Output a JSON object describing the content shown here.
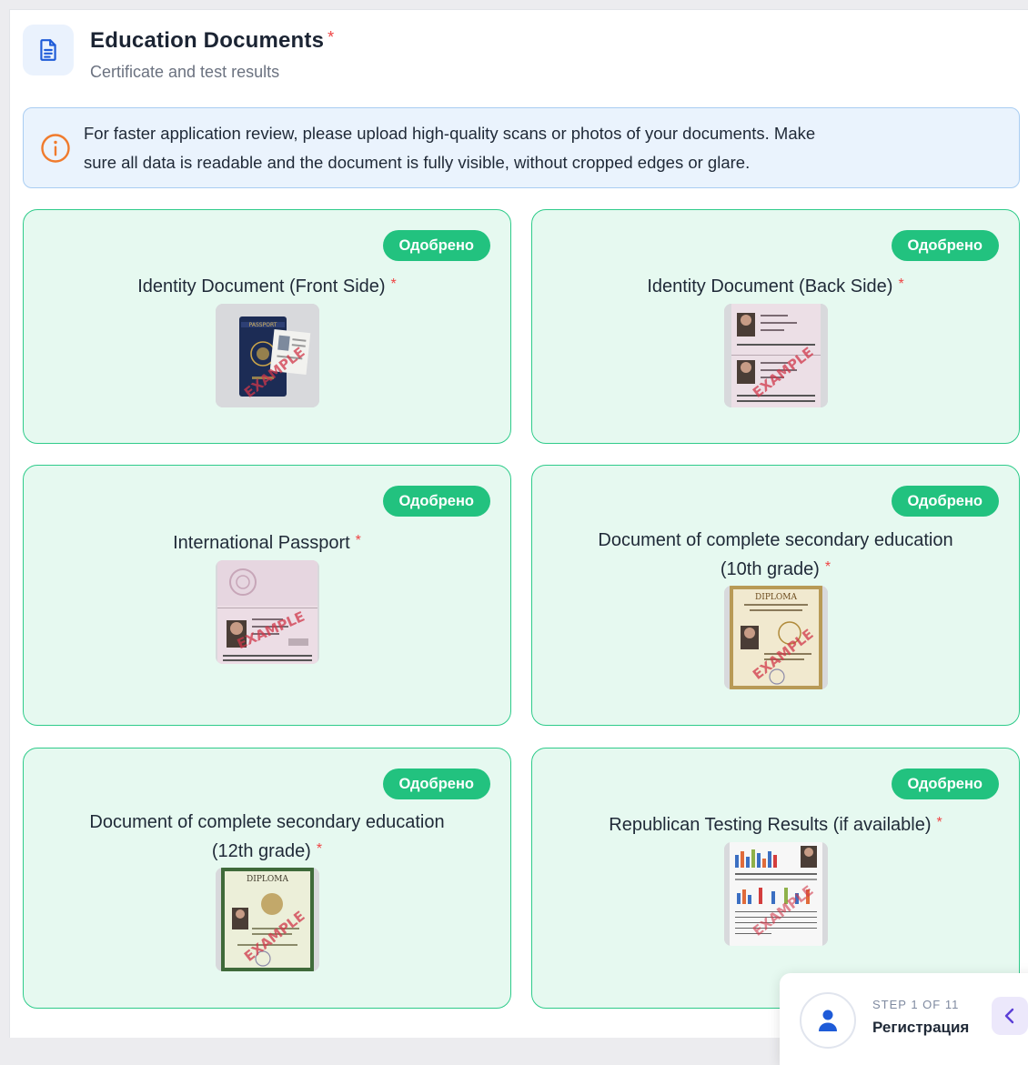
{
  "header": {
    "icon": "document-icon",
    "title": "Education Documents",
    "required_mark": "*",
    "subtitle": "Certificate and test results"
  },
  "notice": {
    "icon": "info-icon",
    "line1": "For faster application review, please upload high-quality scans or photos of your documents. Make",
    "line2": "sure all data is readable and the document is fully visible, without cropped edges or glare."
  },
  "cards": [
    {
      "status": "Одобрено",
      "title_line1": "Identity Document (Front Side)",
      "title_line2": "",
      "required_mark": "*",
      "thumb_icon": "passport-cover-example-image",
      "watermark": "EXAMPLE"
    },
    {
      "status": "Одобрено",
      "title_line1": "Identity Document (Back Side)",
      "title_line2": "",
      "required_mark": "*",
      "thumb_icon": "passport-pages-example-image",
      "watermark": "EXAMPLE"
    },
    {
      "status": "Одобрено",
      "title_line1": "International Passport",
      "title_line2": "",
      "required_mark": "*",
      "thumb_icon": "international-passport-example-image",
      "watermark": "EXAMPLE"
    },
    {
      "status": "Одобрено",
      "title_line1": "Document of complete secondary education",
      "title_line2": "(10th grade)",
      "required_mark": "*",
      "thumb_icon": "diploma-example-image",
      "watermark": "EXAMPLE",
      "thumb_heading": "DIPLOMA"
    },
    {
      "status": "Одобрено",
      "title_line1": "Document of complete secondary education",
      "title_line2": "(12th grade)",
      "required_mark": "*",
      "thumb_icon": "diploma-example-image",
      "watermark": "EXAMPLE",
      "thumb_heading": "DIPLOMA"
    },
    {
      "status": "Одобрено",
      "title_line1": "Republican Testing Results (if available)",
      "title_line2": "",
      "required_mark": "*",
      "thumb_icon": "test-results-example-image",
      "watermark": "EXAMPLE"
    }
  ],
  "stepper": {
    "icon": "user-icon",
    "step_label": "STEP 1 OF 11",
    "step_name": "Регистрация",
    "toggle_icon": "chevron-left-icon"
  },
  "colors": {
    "card_bg": "#e6f9f0",
    "card_border": "#2ecb8a",
    "badge_bg": "#22c27f",
    "notice_bg": "#eaf3fd",
    "notice_border": "#a9cdf2",
    "info_icon": "#f07b2d",
    "required": "#ef4444",
    "accent": "#5b3fd6"
  }
}
